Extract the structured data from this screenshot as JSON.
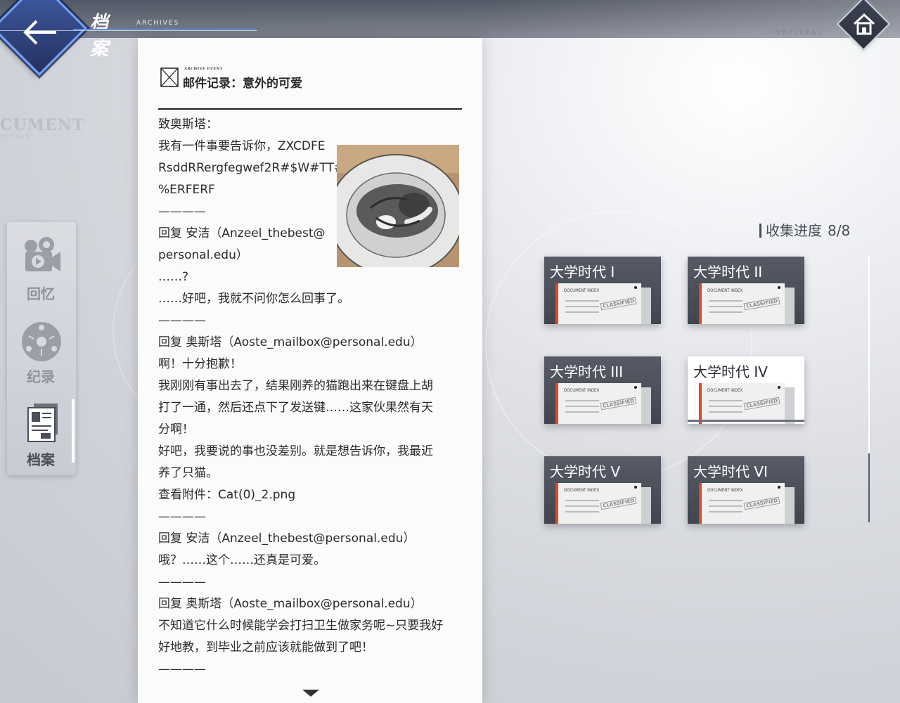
{
  "header": {
    "title": "档案",
    "subtitle": "ARCHIVES"
  },
  "background": {
    "ghost_text": "CUMENT",
    "ghost_small": "ECTION",
    "official": "OFFICIAL"
  },
  "sidebar": {
    "items": [
      {
        "label": "回忆",
        "icon": "camera-icon"
      },
      {
        "label": "纪录",
        "icon": "film-reel-icon"
      },
      {
        "label": "档案",
        "icon": "document-stack-icon",
        "active": true
      }
    ]
  },
  "document": {
    "head_small": "ARCHIVE EVENT",
    "title": "邮件记录：意外的可爱",
    "lines": [
      "致奥斯塔：",
      "我有一件事要告诉你，ZXCDFE",
      "RsddRRergfegwef2R#$W#TT#",
      "%ERFERF",
      "————",
      "回复 安洁（Anzeel_thebest@",
      "personal.edu）",
      "……?",
      "……好吧，我就不问你怎么回事了。",
      "————",
      "回复 奥斯塔（Aoste_mailbox@personal.edu）",
      "啊！十分抱歉！",
      "我刚刚有事出去了，结果刚养的猫跑出来在键盘上胡",
      "打了一通，然后还点下了发送键……这家伙果然有天",
      "分啊！",
      "好吧，我要说的事也没差别。就是想告诉你，我最近",
      "养了只猫。",
      "查看附件：Cat(0)_2.png",
      "————",
      "回复 安洁（Anzeel_thebest@personal.edu）",
      "哦？……这个……还真是可爱。",
      "————",
      "回复 奥斯塔（Aoste_mailbox@personal.edu）",
      "不知道它什么时候能学会打扫卫生做家务呢~只要我好",
      "好地教，到毕业之前应该就能做到了吧！",
      "————"
    ]
  },
  "collection": {
    "label": "收集进度",
    "value": "8/8"
  },
  "cards": [
    {
      "title": "大学时代 I",
      "doc_label": "DOCUMENT INDEX",
      "stamp": "CLASSIFIED",
      "selected": false
    },
    {
      "title": "大学时代 II",
      "doc_label": "DOCUMENT INDEX",
      "stamp": "CLASSIFIED",
      "selected": false
    },
    {
      "title": "大学时代 III",
      "doc_label": "DOCUMENT INDEX",
      "stamp": "CLASSIFIED",
      "selected": false
    },
    {
      "title": "大学时代 IV",
      "doc_label": "DOCUMENT INDEX",
      "stamp": "CLASSIFIED",
      "selected": true
    },
    {
      "title": "大学时代 V",
      "doc_label": "DOCUMENT INDEX",
      "stamp": "CLASSIFIED",
      "selected": false
    },
    {
      "title": "大学时代 VI",
      "doc_label": "DOCUMENT INDEX",
      "stamp": "CLASSIFIED",
      "selected": false
    }
  ],
  "colors": {
    "accent_blue": "#5c8fe8",
    "card_red": "#e04a24",
    "card_dark": "#4a4e58"
  }
}
